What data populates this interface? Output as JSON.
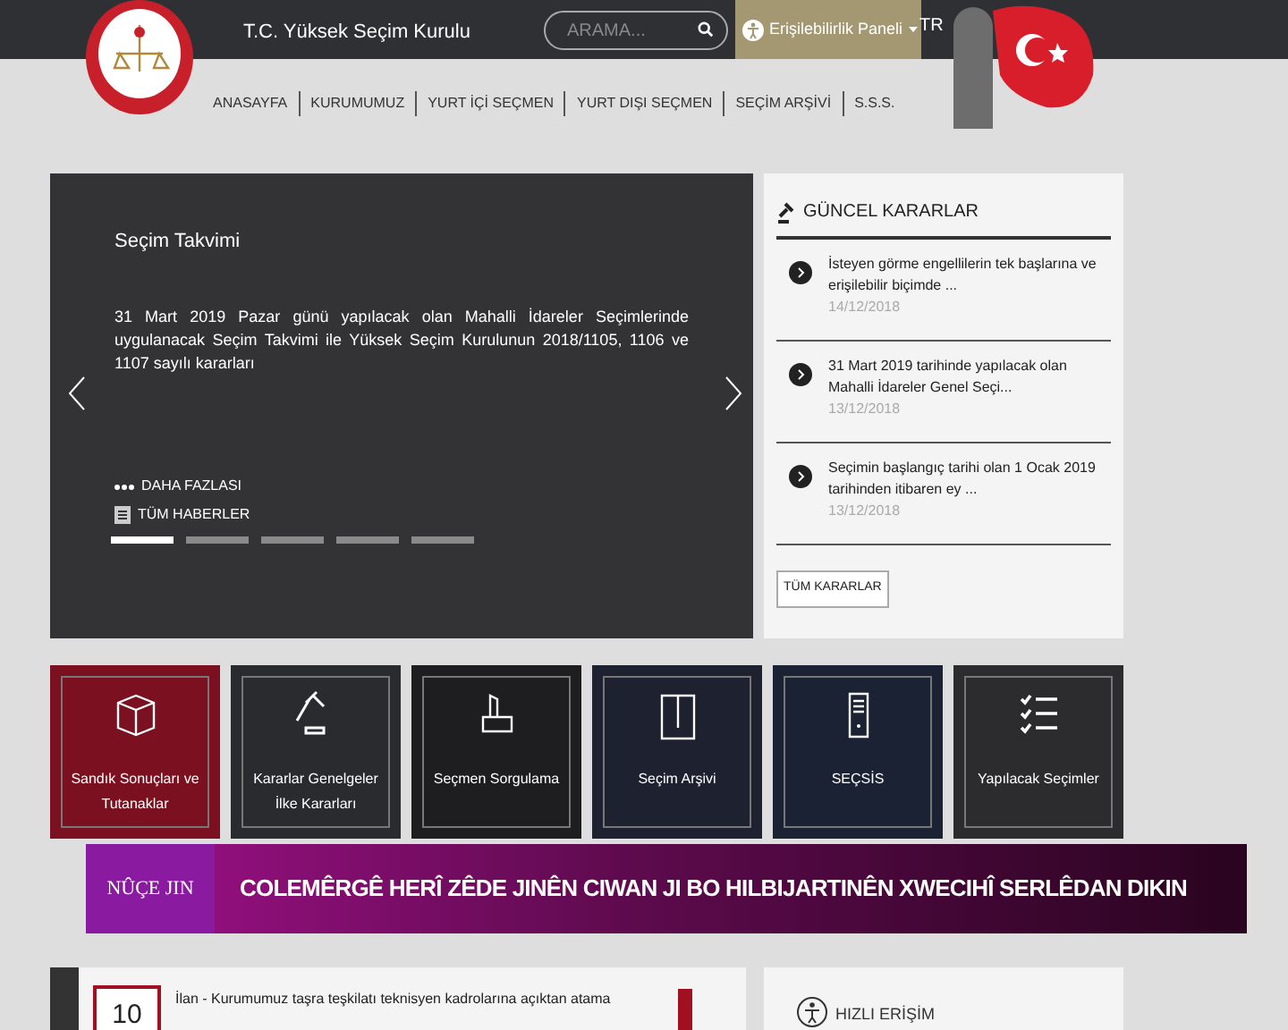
{
  "header": {
    "site_title": "T.C. Yüksek Seçim Kurulu",
    "search": {
      "placeholder": "ARAMA..."
    },
    "accessibility_button": "Erişilebilirlik Paneli",
    "language": "TR"
  },
  "nav": [
    "ANASAYFA",
    "KURUMUMUZ",
    "YURT İÇİ SEÇMEN",
    "YURT DIŞI SEÇMEN",
    "SEÇİM ARŞİVİ",
    "S.S.S."
  ],
  "slider": {
    "title": "Seçim Takvimi",
    "text": "31 Mart 2019 Pazar günü yapılacak olan Mahalli İdareler Seçimlerinde uygulanacak Seçim Takvimi ile Yüksek Seçim Kurulunun 2018/1105, 1106 ve 1107 sayılı kararları",
    "more": "DAHA FAZLASI",
    "all_news": "TÜM HABERLER",
    "dots": [
      {
        "selected": true
      },
      {
        "selected": false
      },
      {
        "selected": false
      },
      {
        "selected": false
      },
      {
        "selected": false
      }
    ]
  },
  "decisions": {
    "title": "GÜNCEL KARARLAR",
    "items": [
      {
        "text": "İsteyen görme engellilerin tek başlarına ve erişilebilir biçimde ...",
        "date": "14/12/2018"
      },
      {
        "text": "31 Mart 2019 tarihinde yapılacak olan Mahalli İdareler Genel Seçi...",
        "date": "13/12/2018"
      },
      {
        "text": "Seçimin başlangıç tarihi olan 1 Ocak 2019 tarihinden itibaren ey ...",
        "date": "13/12/2018"
      }
    ],
    "all_button": "TÜM KARARLAR"
  },
  "tiles": [
    {
      "kind": "box",
      "label": "Sandık Sonuçları ve Tutanaklar",
      "color": "#7a1020"
    },
    {
      "kind": "gavel",
      "label": "Kararlar Genelgeler İlke Kararları",
      "color": "#2a2b2e"
    },
    {
      "kind": "ballot",
      "label": "Seçmen Sorgulama",
      "color": "#1e1d1f"
    },
    {
      "kind": "folder",
      "label": "Seçim Arşivi",
      "color": "#1d2130"
    },
    {
      "kind": "server",
      "label": "SEÇSİS",
      "color": "#1b2233"
    },
    {
      "kind": "checklist",
      "label": "Yapılacak Seçimler",
      "color": "#2c2c2e"
    }
  ],
  "ticker": {
    "channel": "NÛÇE JIN",
    "headline": "COLEMÊRGÊ HERÎ ZÊDE JINÊN CIWAN JI BO HILBIJARTINÊN XWECIHÎ SERLÊDAN DIKIN"
  },
  "announcement": {
    "day": "10",
    "text": "İlan - Kurumumuz taşra teşkilatı teknisyen kadrolarına açıktan atama"
  },
  "quick_access": {
    "title": "HIZLI ERİŞİM"
  }
}
